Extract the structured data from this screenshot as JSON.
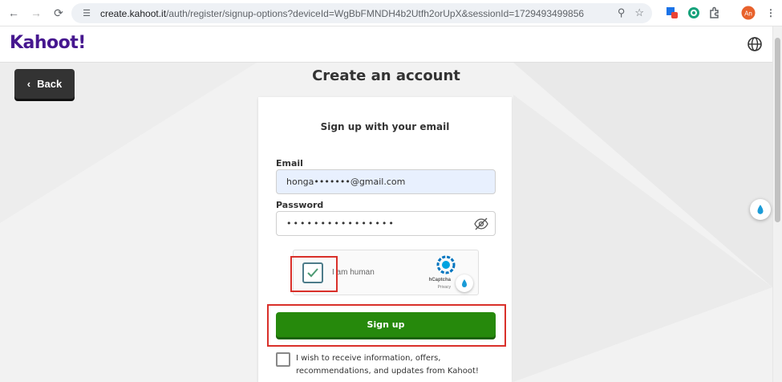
{
  "browser": {
    "url_host": "create.kahoot.it",
    "url_path": "/auth/register/signup-options?deviceId=WgBbFMNDH4b2Utfh2orUpX&sessionId=1729493499856",
    "profile_initials": "An"
  },
  "site": {
    "logo": "Kahoot!"
  },
  "back_button": {
    "label": "Back"
  },
  "page": {
    "title": "Create an account",
    "subtitle": "Sign up with your email"
  },
  "form": {
    "email_label": "Email",
    "email_value": "honga•••••••@gmail.com",
    "password_label": "Password",
    "password_value": "••••••••••••••••",
    "captcha_label": "I am human",
    "captcha_brand": "hCaptcha",
    "captcha_privacy": "Privacy",
    "signup_label": "Sign up",
    "marketing_optin": "I wish to receive information, offers, recommendations, and updates from Kahoot!"
  },
  "colors": {
    "brand_purple": "#46178f",
    "signup_green": "#26890c",
    "highlight_red": "#d9302a"
  }
}
